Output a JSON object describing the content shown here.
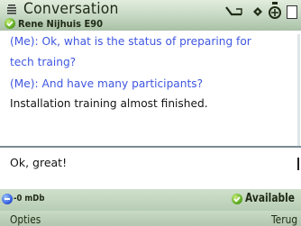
{
  "header": {
    "title": "Conversation",
    "contact_name": "Rene Nijhuis E90"
  },
  "messages": [
    {
      "sender": "me",
      "text": "(Me): Ok, what is the status of preparing for"
    },
    {
      "sender": "me",
      "text": "tech traing?"
    },
    {
      "sender": "me",
      "text": "(Me): And have many participants?"
    },
    {
      "sender": "contact",
      "text": "Installation training almost finished."
    }
  ],
  "input": {
    "value": "Ok, great!"
  },
  "status": {
    "network_text": "-0 mDb",
    "availability": "Available"
  },
  "softkeys": {
    "left": "Opties",
    "right": "Terug"
  },
  "colors": {
    "own_message": "#3f57e0",
    "contact_message": "#141414",
    "bar_background": "#c4d7c1",
    "available_green": "#53a21b"
  }
}
